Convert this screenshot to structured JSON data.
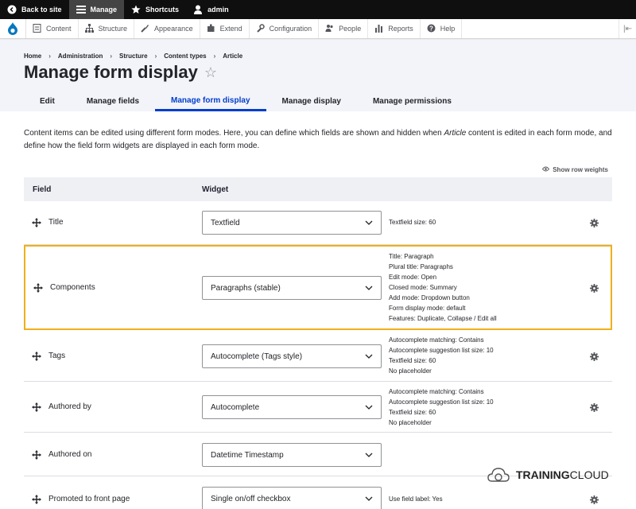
{
  "toolbar": {
    "back_to_site": "Back to site",
    "manage": "Manage",
    "shortcuts": "Shortcuts",
    "user": "admin"
  },
  "admin_menu": {
    "items": [
      {
        "label": "Content",
        "icon": "content-icon"
      },
      {
        "label": "Structure",
        "icon": "structure-icon"
      },
      {
        "label": "Appearance",
        "icon": "appearance-icon"
      },
      {
        "label": "Extend",
        "icon": "extend-icon"
      },
      {
        "label": "Configuration",
        "icon": "wrench-icon"
      },
      {
        "label": "People",
        "icon": "people-icon"
      },
      {
        "label": "Reports",
        "icon": "reports-icon"
      },
      {
        "label": "Help",
        "icon": "help-icon"
      }
    ]
  },
  "breadcrumb": [
    "Home",
    "Administration",
    "Structure",
    "Content types",
    "Article"
  ],
  "breadcrumb_separator": "›",
  "page": {
    "title": "Manage form display",
    "tabs": [
      "Edit",
      "Manage fields",
      "Manage form display",
      "Manage display",
      "Manage permissions"
    ],
    "active_tab": 2,
    "description_before": "Content items can be edited using different form modes. Here, you can define which fields are shown and hidden when ",
    "description_em": "Article",
    "description_after": " content is edited in each form mode, and define how the field form widgets are displayed in each form mode.",
    "row_weights": "Show row weights"
  },
  "table": {
    "headers": {
      "field": "Field",
      "widget": "Widget"
    },
    "rows": [
      {
        "field": "Title",
        "widget": "Textfield",
        "summary": [
          "Textfield size: 60"
        ]
      },
      {
        "field": "Components",
        "widget": "Paragraphs (stable)",
        "highlight": true,
        "summary": [
          "Title: Paragraph",
          "Plural title: Paragraphs",
          "Edit mode: Open",
          "Closed mode: Summary",
          "Add mode: Dropdown button",
          "Form display mode: default",
          "Features: Duplicate, Collapse / Edit all"
        ]
      },
      {
        "field": "Tags",
        "widget": "Autocomplete (Tags style)",
        "summary": [
          "Autocomplete matching: Contains",
          "Autocomplete suggestion list size: 10",
          "Textfield size: 60",
          "No placeholder"
        ]
      },
      {
        "field": "Authored by",
        "widget": "Autocomplete",
        "summary": [
          "Autocomplete matching: Contains",
          "Autocomplete suggestion list size: 10",
          "Textfield size: 60",
          "No placeholder"
        ]
      },
      {
        "field": "Authored on",
        "widget": "Datetime Timestamp",
        "summary": []
      },
      {
        "field": "Promoted to front page",
        "widget": "Single on/off checkbox",
        "summary": [
          "Use field label: Yes"
        ]
      }
    ]
  },
  "watermark": {
    "part1": "TRAINING",
    "part2": "CLOUD"
  },
  "colors": {
    "accent": "#003ecc",
    "highlight": "#f0b019",
    "toolbar": "#0f0f0f"
  }
}
